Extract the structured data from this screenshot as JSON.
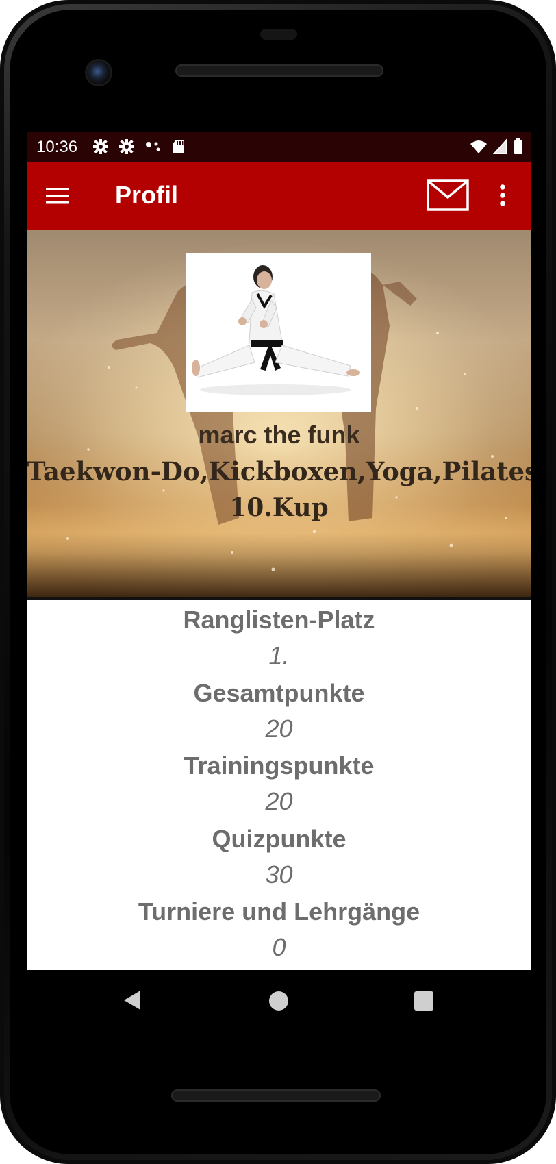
{
  "status_bar": {
    "time": "10:36",
    "left_icons": [
      "settings-gear-icon",
      "settings-gear-icon",
      "dots-icon",
      "sd-card-icon"
    ],
    "right_icons": [
      "wifi-icon",
      "signal-icon",
      "battery-icon"
    ]
  },
  "app_bar": {
    "title": "Profil",
    "background_color": "#b30000"
  },
  "profile": {
    "name": "marc  the funk",
    "sports": "Taekwon-Do,Kickboxen,Yoga,Pilates",
    "rank": "10.Kup"
  },
  "stats": [
    {
      "label": "Ranglisten-Platz",
      "value": "1."
    },
    {
      "label": "Gesamtpunkte",
      "value": "20"
    },
    {
      "label": "Trainingspunkte",
      "value": "20"
    },
    {
      "label": "Quizpunkte",
      "value": "30"
    },
    {
      "label": "Turniere und Lehrgänge",
      "value": "0"
    }
  ]
}
